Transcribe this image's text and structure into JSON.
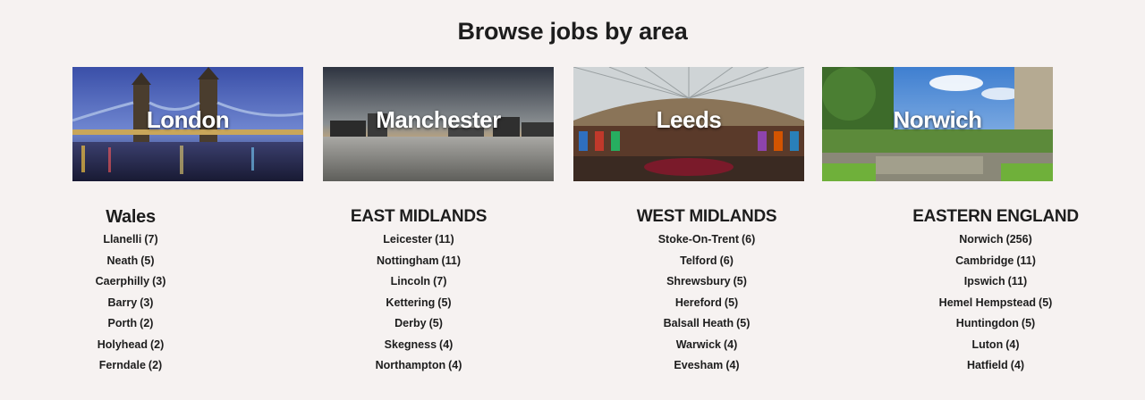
{
  "heading": "Browse jobs by area",
  "cities": [
    {
      "label": "London"
    },
    {
      "label": "Manchester"
    },
    {
      "label": "Leeds"
    },
    {
      "label": "Norwich"
    }
  ],
  "regions": [
    {
      "title": "Wales",
      "items": [
        {
          "name": "Llanelli",
          "count": "(7)"
        },
        {
          "name": "Neath",
          "count": "(5)"
        },
        {
          "name": "Caerphilly",
          "count": "(3)"
        },
        {
          "name": "Barry",
          "count": "(3)"
        },
        {
          "name": "Porth",
          "count": "(2)"
        },
        {
          "name": "Holyhead",
          "count": "(2)"
        },
        {
          "name": "Ferndale",
          "count": "(2)"
        }
      ]
    },
    {
      "title": "EAST MIDLANDS",
      "items": [
        {
          "name": "Leicester",
          "count": "(11)"
        },
        {
          "name": "Nottingham",
          "count": "(11)"
        },
        {
          "name": "Lincoln",
          "count": "(7)"
        },
        {
          "name": "Kettering",
          "count": "(5)"
        },
        {
          "name": "Derby",
          "count": "(5)"
        },
        {
          "name": "Skegness",
          "count": "(4)"
        },
        {
          "name": "Northampton",
          "count": "(4)"
        }
      ]
    },
    {
      "title": "WEST MIDLANDS",
      "items": [
        {
          "name": "Stoke-On-Trent",
          "count": "(6)"
        },
        {
          "name": "Telford",
          "count": "(6)"
        },
        {
          "name": "Shrewsbury",
          "count": "(5)"
        },
        {
          "name": "Hereford",
          "count": "(5)"
        },
        {
          "name": "Balsall Heath",
          "count": "(5)"
        },
        {
          "name": "Warwick",
          "count": "(4)"
        },
        {
          "name": "Evesham",
          "count": "(4)"
        }
      ]
    },
    {
      "title": "EASTERN ENGLAND",
      "items": [
        {
          "name": "Norwich",
          "count": "(256)"
        },
        {
          "name": "Cambridge",
          "count": "(11)"
        },
        {
          "name": "Ipswich",
          "count": "(11)"
        },
        {
          "name": "Hemel Hempstead",
          "count": "(5)"
        },
        {
          "name": "Huntingdon",
          "count": "(5)"
        },
        {
          "name": "Luton",
          "count": "(4)"
        },
        {
          "name": "Hatfield",
          "count": "(4)"
        }
      ]
    }
  ]
}
